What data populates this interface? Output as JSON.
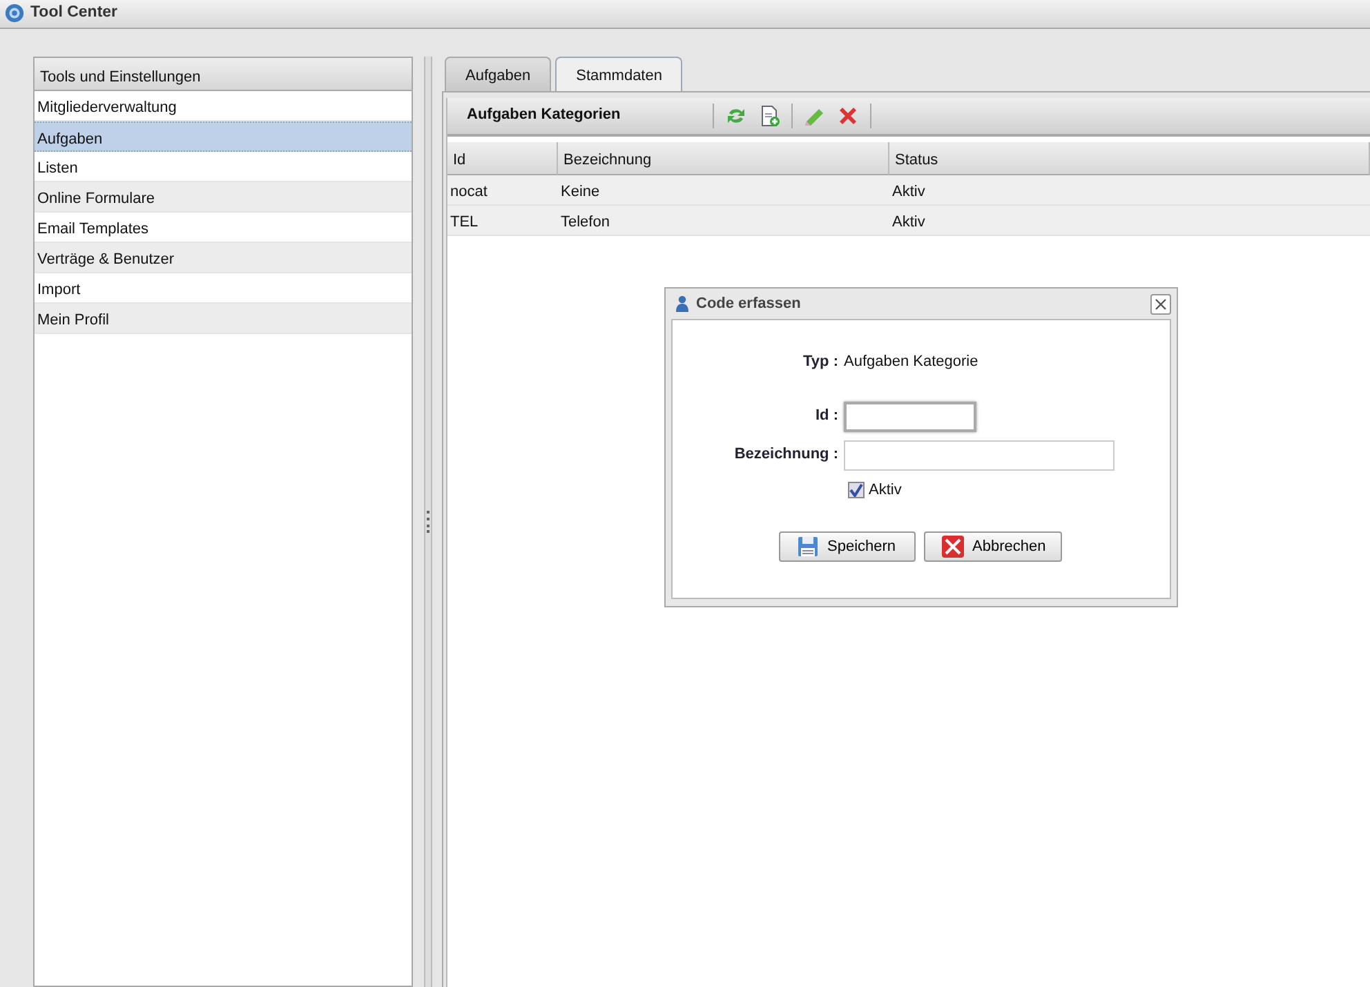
{
  "window": {
    "title": "Tool Center"
  },
  "sidebar": {
    "title": "Tools und Einstellungen",
    "items": [
      {
        "label": "Mitgliederverwaltung",
        "selected": false
      },
      {
        "label": "Aufgaben",
        "selected": true
      },
      {
        "label": "Listen",
        "selected": false
      },
      {
        "label": "Online Formulare",
        "selected": false
      },
      {
        "label": "Email Templates",
        "selected": false
      },
      {
        "label": "Verträge & Benutzer",
        "selected": false
      },
      {
        "label": "Import",
        "selected": false
      },
      {
        "label": "Mein Profil",
        "selected": false
      }
    ]
  },
  "tabs": [
    {
      "label": "Aufgaben",
      "selected": false
    },
    {
      "label": "Stammdaten",
      "selected": true
    }
  ],
  "panel": {
    "title": "Aufgaben Kategorien"
  },
  "table": {
    "columns": [
      "Id",
      "Bezeichnung",
      "Status"
    ],
    "rows": [
      [
        "nocat",
        "Keine",
        "Aktiv"
      ],
      [
        "TEL",
        "Telefon",
        "Aktiv"
      ]
    ]
  },
  "dialog": {
    "title": "Code erfassen",
    "type_label": "Typ :",
    "type_value": "Aufgaben Kategorie",
    "fields": [
      {
        "label": "Id :",
        "focused": true
      },
      {
        "label": "Bezeichnung :",
        "focused": false
      }
    ],
    "checkbox": {
      "label": "Aktiv",
      "checked": true
    },
    "buttons": [
      {
        "label": "Speichern",
        "kind": "save"
      },
      {
        "label": "Abbrechen",
        "kind": "cancel"
      }
    ]
  }
}
